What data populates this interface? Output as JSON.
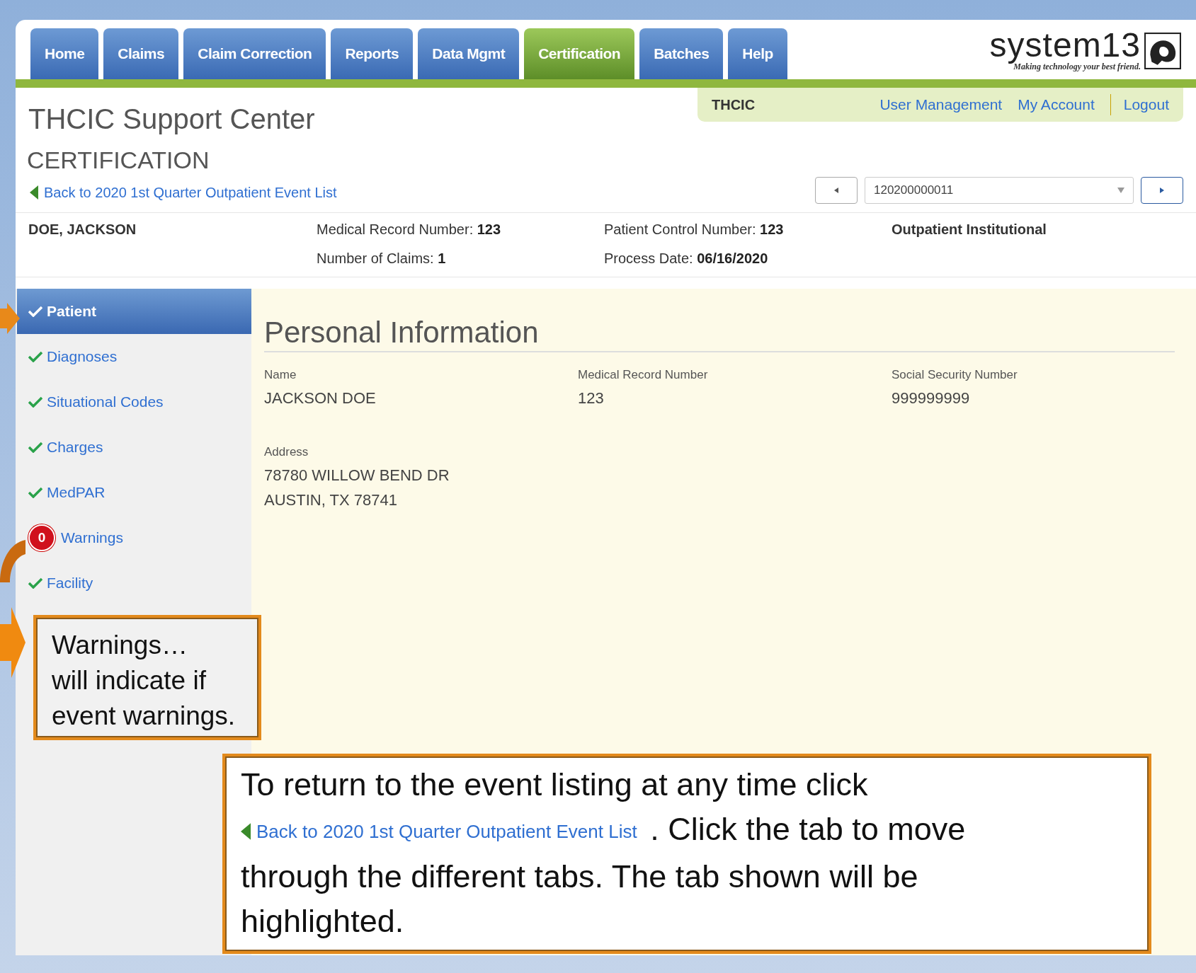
{
  "nav": {
    "tabs": [
      {
        "label": "Home",
        "selected": false
      },
      {
        "label": "Claims",
        "selected": false
      },
      {
        "label": "Claim Correction",
        "selected": false
      },
      {
        "label": "Reports",
        "selected": false
      },
      {
        "label": "Data Mgmt",
        "selected": false
      },
      {
        "label": "Certification",
        "selected": true
      },
      {
        "label": "Batches",
        "selected": false
      },
      {
        "label": "Help",
        "selected": false
      }
    ]
  },
  "logo": {
    "name": "system13",
    "tagline": "Making technology your best friend."
  },
  "site_title": "THCIC Support Center",
  "account_bar": {
    "org": "THCIC",
    "links": [
      "User Management",
      "My Account",
      "Logout"
    ]
  },
  "page": {
    "heading": "CERTIFICATION",
    "back_link": "Back to 2020 1st Quarter Outpatient Event List"
  },
  "pager": {
    "value": "120200000011"
  },
  "patient_header": {
    "name": "DOE, JACKSON",
    "type": "Outpatient Institutional",
    "fields": [
      {
        "label": "Medical Record Number:",
        "value": "123"
      },
      {
        "label": "Patient Control Number:",
        "value": "123"
      },
      {
        "label": "Number of Claims:",
        "value": "1"
      },
      {
        "label": "Process Date:",
        "value": "06/16/2020"
      }
    ]
  },
  "sidebar": {
    "items": [
      {
        "label": "Patient",
        "selected": true,
        "kind": "check"
      },
      {
        "label": "Diagnoses",
        "selected": false,
        "kind": "check"
      },
      {
        "label": "Situational Codes",
        "selected": false,
        "kind": "check"
      },
      {
        "label": "Charges",
        "selected": false,
        "kind": "check"
      },
      {
        "label": "MedPAR",
        "selected": false,
        "kind": "check"
      },
      {
        "label": "Warnings",
        "selected": false,
        "kind": "count",
        "count": "0"
      },
      {
        "label": "Facility",
        "selected": false,
        "kind": "check"
      }
    ]
  },
  "content": {
    "section_title": "Personal Information",
    "fields": [
      {
        "label": "Name",
        "lines": [
          "JACKSON DOE"
        ]
      },
      {
        "label": "Medical Record Number",
        "lines": [
          "123"
        ]
      },
      {
        "label": "Social Security Number",
        "lines": [
          "999999999"
        ]
      },
      {
        "label": "Address",
        "lines": [
          "78780 WILLOW BEND DR",
          "AUSTIN, TX 78741"
        ]
      }
    ]
  },
  "callouts": [
    {
      "lines": [
        "Warnings…",
        "will indicate if",
        "event warnings."
      ]
    },
    {
      "before": "To return to the event listing at any time click",
      "link": "Back to 2020 1st Quarter Outpatient Event List",
      "after": ".  Click the tab to move through the different tabs. The tab shown will be highlighted."
    }
  ]
}
